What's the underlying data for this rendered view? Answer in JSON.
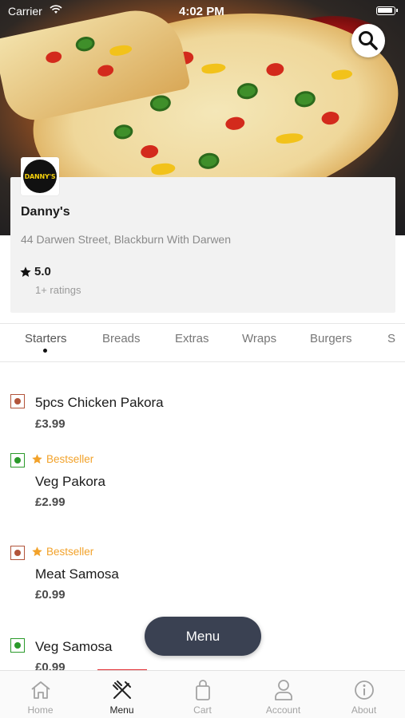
{
  "status_bar": {
    "carrier": "Carrier",
    "time": "4:02 PM"
  },
  "restaurant": {
    "logo_text": "DANNY'S",
    "name": "Danny's",
    "address": "44 Darwen Street, Blackburn With Darwen",
    "rating": "5.0",
    "rating_count": "1+ ratings"
  },
  "tabs": [
    {
      "label": "Starters",
      "active": true
    },
    {
      "label": "Breads"
    },
    {
      "label": "Extras"
    },
    {
      "label": "Wraps"
    },
    {
      "label": "Burgers"
    },
    {
      "label": "S"
    }
  ],
  "menu_items": [
    {
      "name": "5pcs Chicken Pakora",
      "price": "£3.99",
      "type": "non-veg",
      "badge": ""
    },
    {
      "name": "Veg Pakora",
      "price": "£2.99",
      "type": "veg",
      "badge": "Bestseller"
    },
    {
      "name": "Meat Samosa",
      "price": "£0.99",
      "type": "non-veg",
      "badge": "Bestseller"
    },
    {
      "name": "Veg Samosa",
      "price": "£0.99",
      "type": "veg",
      "badge": ""
    }
  ],
  "floating_button": {
    "label": "Menu"
  },
  "bottom_nav": [
    {
      "label": "Home",
      "icon": "home-icon"
    },
    {
      "label": "Menu",
      "icon": "fork-knife-icon",
      "active": true
    },
    {
      "label": "Cart",
      "icon": "shopping-bag-icon"
    },
    {
      "label": "Account",
      "icon": "user-icon"
    },
    {
      "label": "About",
      "icon": "info-icon"
    }
  ],
  "colors": {
    "accent": "#e0262b",
    "bestseller": "#f2a22a",
    "veg": "#2b9a2b",
    "non_veg": "#b2543a",
    "fab": "#3a4152"
  }
}
